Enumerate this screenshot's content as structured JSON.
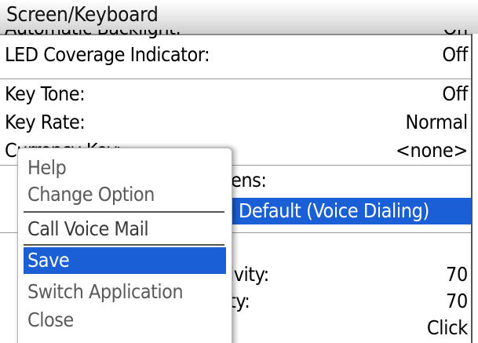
{
  "screen": {
    "title": "Screen/Keyboard"
  },
  "options": [
    {
      "label": "Automatic Backlight:",
      "value": "On"
    },
    {
      "label": "LED Coverage Indicator:",
      "value": "Off"
    },
    {
      "label": "Key Tone:",
      "value": "Off"
    },
    {
      "label": "Key Rate:",
      "value": "Normal"
    },
    {
      "label": "Currency Key:",
      "value": "<none>"
    },
    {
      "label": "ens:",
      "value": ""
    },
    {
      "label": "",
      "value": "Default (Voice Dialing)"
    },
    {
      "label": "ivity:",
      "value": "70"
    },
    {
      "label": "ty:",
      "value": "70"
    },
    {
      "label": "",
      "value": "Click"
    }
  ],
  "menu": {
    "items": [
      {
        "label": "Help"
      },
      {
        "label": "Change Option"
      },
      {
        "label": "Call Voice Mail"
      },
      {
        "label": "Save",
        "selected": true
      },
      {
        "label": "Switch Application"
      },
      {
        "label": "Close"
      }
    ]
  },
  "colors": {
    "selection": "#1a5fd6",
    "background": "#ffffff"
  }
}
